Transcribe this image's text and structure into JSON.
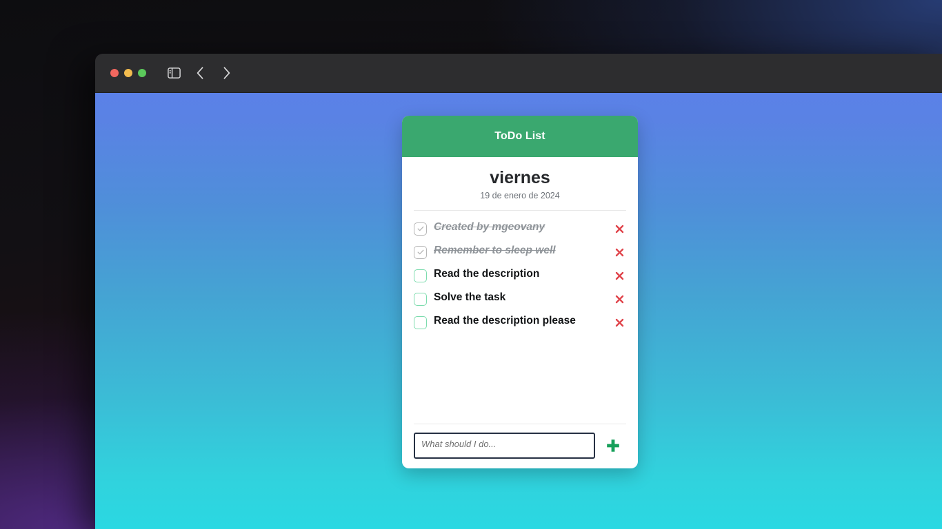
{
  "browser": {
    "traffic_lights": [
      "close",
      "minimize",
      "maximize"
    ],
    "sidebar_toggle": "sidebar-icon",
    "back_label": "back-icon",
    "forward_label": "forward-icon",
    "address_value": "",
    "address_placeholder": "",
    "reload_label": "reload-icon"
  },
  "card": {
    "header_title": "ToDo List",
    "day_name": "viernes",
    "full_date": "19 de enero de 2024",
    "tasks": [
      {
        "text": "Created by mgeovany",
        "done": true
      },
      {
        "text": "Remember to sleep well",
        "done": true
      },
      {
        "text": "Read the description",
        "done": false
      },
      {
        "text": "Solve the task",
        "done": false
      },
      {
        "text": "Read the description please",
        "done": false
      }
    ],
    "input_value": "",
    "input_placeholder": "What should I do...",
    "add_button_label": "+",
    "colors": {
      "header_green": "#3aa86f",
      "checkbox_green": "#7ddcae",
      "checkbox_gray": "#b6b6b6",
      "delete_red": "#e0434a",
      "add_green": "#17a05a",
      "input_border": "#263043",
      "page_gradient_top": "#5b81e8",
      "page_gradient_bottom": "#2ad8e2"
    }
  }
}
